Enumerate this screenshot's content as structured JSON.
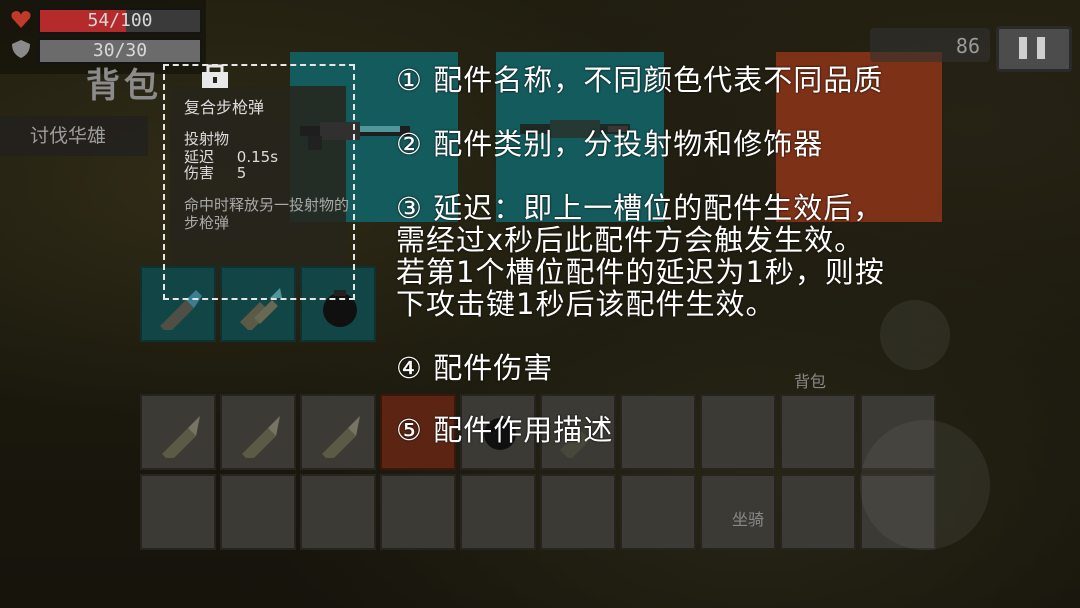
{
  "hud": {
    "hp_text": "54/100",
    "hp_fraction": 0.54,
    "shield_text": "30/30",
    "shield_fraction": 1.0,
    "coins": "86"
  },
  "bag_title": "背包",
  "quest_label": "讨伐华雄",
  "tooltip": {
    "name": "复合步枪弹",
    "type": "投射物",
    "delay_label": "延迟",
    "delay_value": "0.15s",
    "damage_label": "伤害",
    "damage_value": "5",
    "description": "命中时释放另一投射物的步枪弹"
  },
  "notes": [
    {
      "num": "①",
      "text": "配件名称，不同颜色代表不同品质"
    },
    {
      "num": "②",
      "text": "配件类别，分投射物和修饰器"
    },
    {
      "num": "③",
      "lines": [
        "延迟：即上一槽位的配件生效后，",
        "需经过x秒后此配件方会触发生效。",
        "若第1个槽位配件的延迟为1秒，则按",
        "下攻击键1秒后该配件生效。"
      ]
    },
    {
      "num": "④",
      "text": "配件伤害"
    },
    {
      "num": "⑤",
      "text": "配件作用描述"
    }
  ],
  "side_buttons": {
    "bag": "背包",
    "mount": "坐骑"
  },
  "colors": {
    "hp": "#b52a2a",
    "cyan_slot": "#1f8c8f",
    "orange_panel": "#c04c22",
    "slot_gray": "#5d5a52"
  }
}
